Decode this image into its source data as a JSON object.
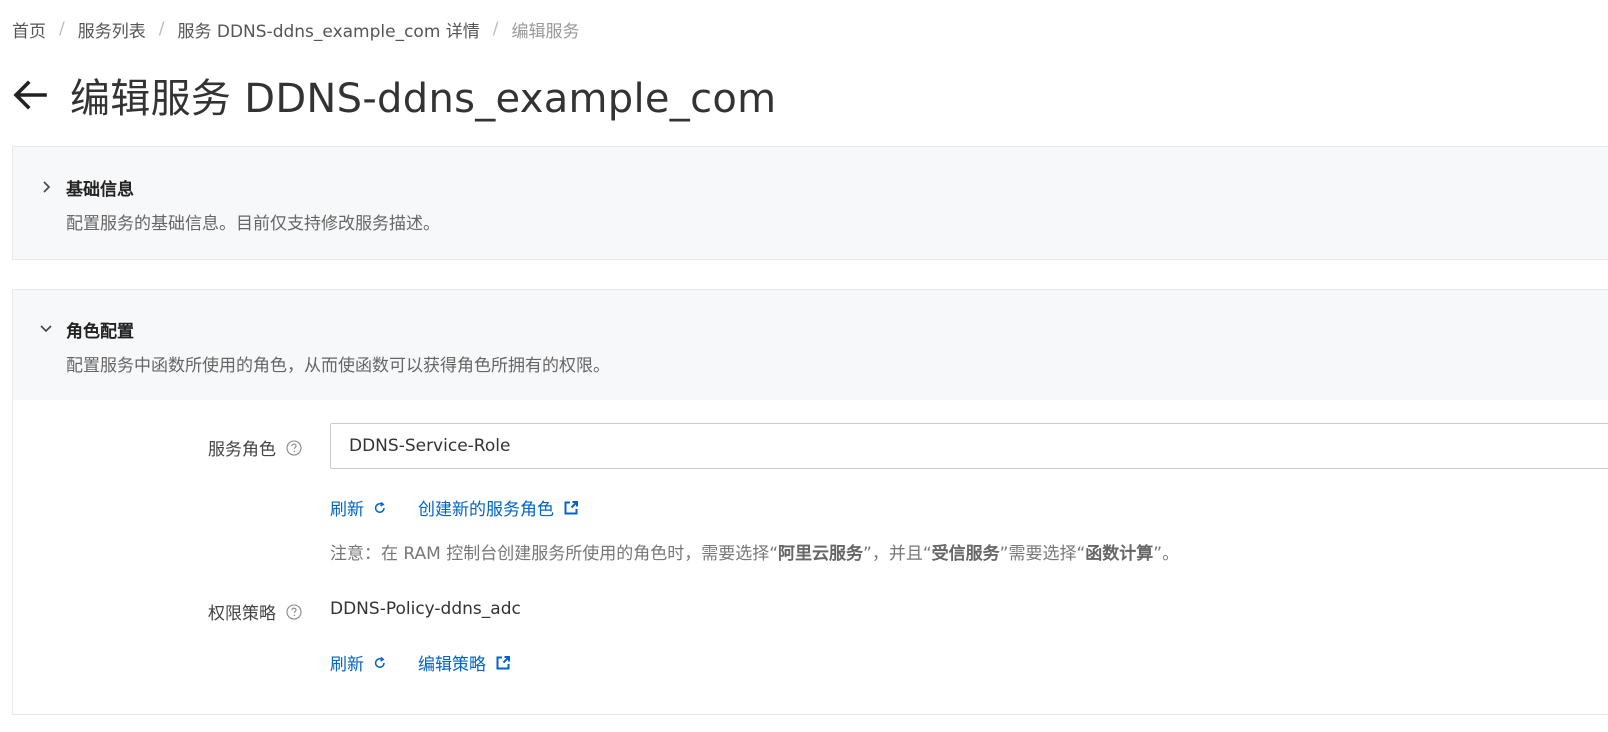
{
  "breadcrumb": {
    "items": [
      "首页",
      "服务列表",
      "服务 DDNS-ddns_example_com 详情"
    ],
    "current": "编辑服务",
    "separator": "/"
  },
  "header": {
    "back_icon": "arrow-left-icon",
    "title": "编辑服务 DDNS-ddns_example_com"
  },
  "basic_info": {
    "title": "基础信息",
    "description": "配置服务的基础信息。目前仅支持修改服务描述。",
    "expanded": false,
    "icon": "chevron-right-icon"
  },
  "role_config": {
    "title": "角色配置",
    "description": "配置服务中函数所使用的角色，从而使函数可以获得角色所拥有的权限。",
    "expanded": true,
    "icon": "chevron-down-icon",
    "service_role": {
      "label": "服务角色",
      "value": "DDNS-Service-Role",
      "refresh_label": "刷新",
      "create_label": "创建新的服务角色"
    },
    "note": {
      "prefix": "注意：在 RAM 控制台创建服务所使用的角色时，需要选择“",
      "term1": "阿里云服务",
      "mid1": "”，并且“",
      "term2": "受信服务",
      "mid2": "”需要选择“",
      "term3": "函数计算",
      "suffix": "”。"
    },
    "policy": {
      "label": "权限策略",
      "value": "DDNS-Policy-ddns_adc",
      "refresh_label": "刷新",
      "edit_label": "编辑策略"
    }
  },
  "colors": {
    "link": "#0064c8",
    "panel_header_bg": "#f7f8fa",
    "border": "#e6e8eb"
  }
}
